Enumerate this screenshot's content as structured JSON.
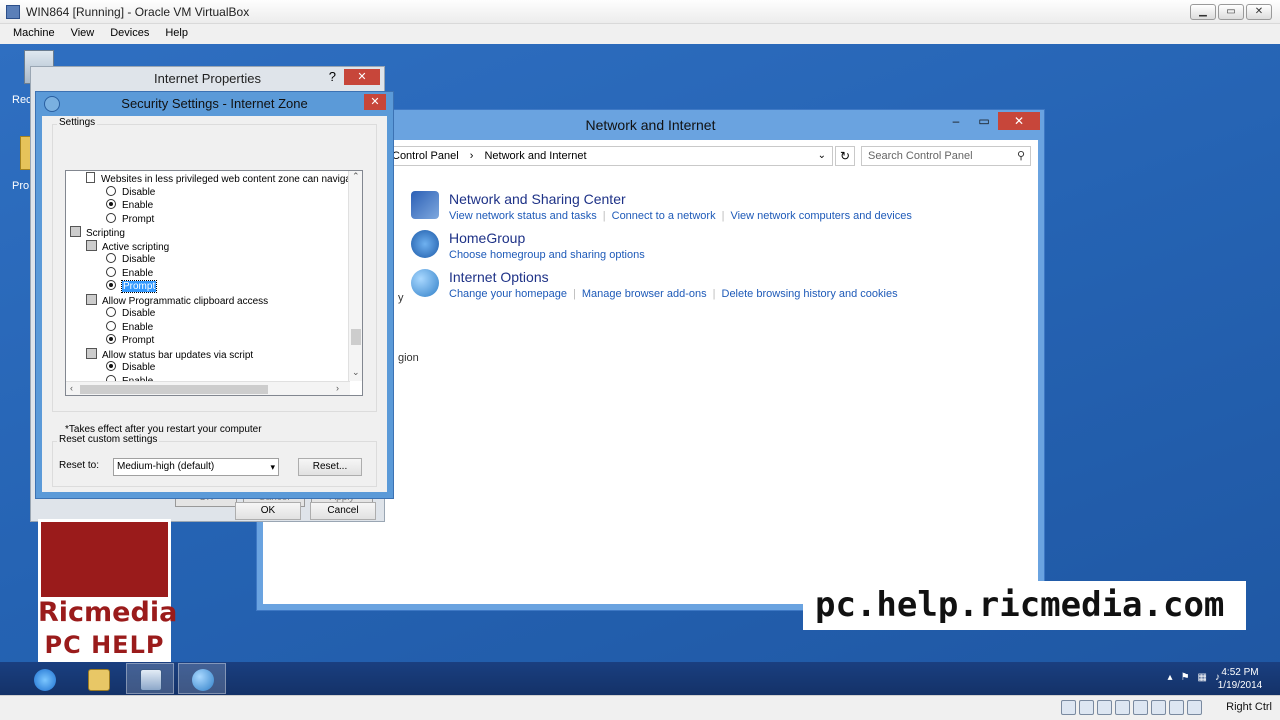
{
  "vbox": {
    "title": "WIN864 [Running] - Oracle VM VirtualBox",
    "menu": [
      "Machine",
      "View",
      "Devices",
      "Help"
    ],
    "win_buttons": [
      "▁",
      "▭",
      "✕"
    ],
    "host_key": "Right Ctrl"
  },
  "desktop": {
    "icon1_label": "Rec",
    "icon2_label": "Pro"
  },
  "control_panel": {
    "title": "Network and Internet",
    "breadcrumb": [
      "Control Panel",
      "›",
      "Network and Internet"
    ],
    "search_placeholder": "Search Control Panel",
    "partial_text_1": "y",
    "partial_text_2": "gion",
    "categories": [
      {
        "title": "Network and Sharing Center",
        "links": [
          "View network status and tasks",
          "Connect to a network",
          "View network computers and devices"
        ]
      },
      {
        "title": "HomeGroup",
        "links": [
          "Choose homegroup and sharing options"
        ]
      },
      {
        "title": "Internet Options",
        "links": [
          "Change your homepage",
          "Manage browser add-ons",
          "Delete browsing history and cookies"
        ]
      }
    ]
  },
  "internet_properties": {
    "title": "Internet Properties",
    "help": "?",
    "buttons": [
      "OK",
      "Cancel",
      "Apply"
    ]
  },
  "security_settings": {
    "title": "Security Settings - Internet Zone",
    "settings_label": "Settings",
    "tree": [
      {
        "kind": "doc",
        "text": "Websites in less privileged web content zone can navigate in"
      },
      {
        "kind": "radio",
        "text": "Disable",
        "checked": false
      },
      {
        "kind": "radio",
        "text": "Enable",
        "checked": true
      },
      {
        "kind": "radio",
        "text": "Prompt",
        "checked": false
      },
      {
        "kind": "group",
        "text": "Scripting"
      },
      {
        "kind": "gear",
        "text": "Active scripting"
      },
      {
        "kind": "radio",
        "text": "Disable",
        "checked": false
      },
      {
        "kind": "radio",
        "text": "Enable",
        "checked": false
      },
      {
        "kind": "radio",
        "text": "Prompt",
        "checked": true,
        "selected": true
      },
      {
        "kind": "gear",
        "text": "Allow Programmatic clipboard access"
      },
      {
        "kind": "radio",
        "text": "Disable",
        "checked": false
      },
      {
        "kind": "radio",
        "text": "Enable",
        "checked": false
      },
      {
        "kind": "radio",
        "text": "Prompt",
        "checked": true
      },
      {
        "kind": "gear",
        "text": "Allow status bar updates via script"
      },
      {
        "kind": "radio",
        "text": "Disable",
        "checked": true
      },
      {
        "kind": "radio",
        "text": "Enable",
        "checked": false
      }
    ],
    "note": "*Takes effect after you restart your computer",
    "reset_group_label": "Reset custom settings",
    "reset_to_label": "Reset to:",
    "reset_value": "Medium-high (default)",
    "reset_button": "Reset...",
    "ok": "OK",
    "cancel": "Cancel"
  },
  "branding": {
    "logo_name": "Ricmedia",
    "logo_sub": "PC HELP",
    "url": "pc.help.ricmedia.com"
  },
  "taskbar": {
    "time": "4:52 PM",
    "date": "1/19/2014"
  },
  "colors": {
    "desktop": "#2563b3",
    "accent_red": "#9a1b1b",
    "link_blue": "#1e5ab8"
  }
}
